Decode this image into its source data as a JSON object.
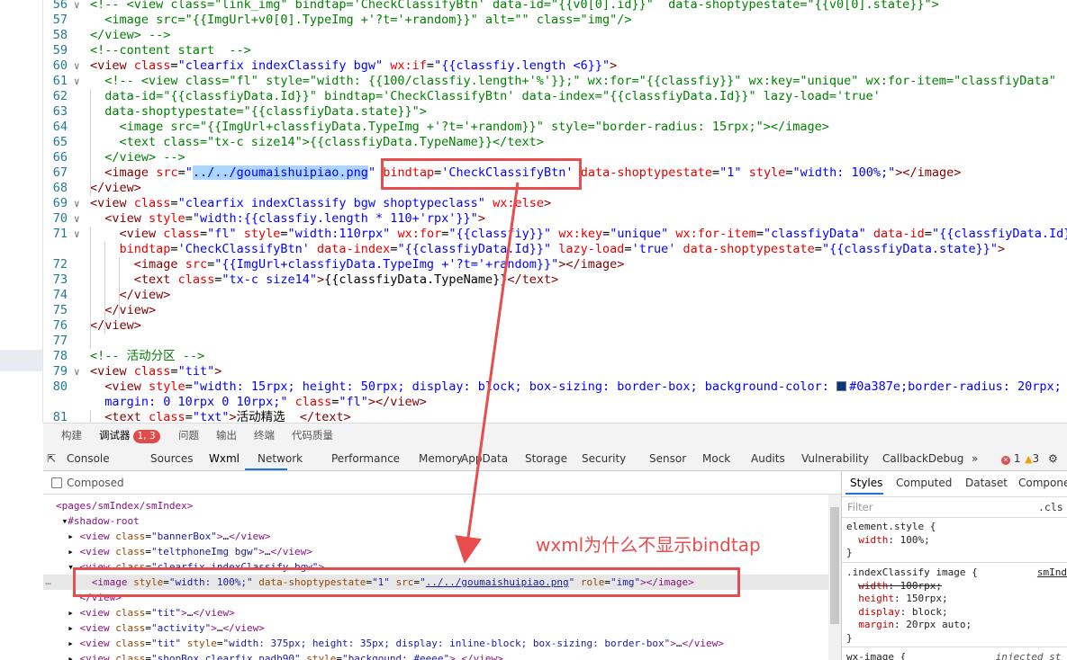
{
  "editor": {
    "lines": [
      {
        "num": "56",
        "fold": "∨",
        "html": "<span class=\"c\">&lt;!-- &lt;view class=\"link_img\" bindtap='CheckClassifyBtn' data-id=\"{{v0[0].id}}\"  data-shoptypestate=\"{{v0[0].state}}\"&gt;</span>"
      },
      {
        "num": "57",
        "fold": "",
        "html": "<span class=\"c\">  &lt;image src=\"{{ImgUrl+v0[0].TypeImg +'?t='+random}}\" alt=\"\" class=\"img\"/&gt;</span>"
      },
      {
        "num": "58",
        "fold": "",
        "html": "<span class=\"c\">&lt;/view&gt; --&gt;</span>"
      },
      {
        "num": "59",
        "fold": "",
        "html": "<span class=\"c\">&lt;!--content start  --&gt;</span>"
      },
      {
        "num": "60",
        "fold": "∨",
        "html": "<span class=\"t\">&lt;view</span> <span class=\"a\">class</span>=<span class=\"v\">\"clearfix indexClassify bgw\"</span> <span class=\"a\">wx:if</span>=<span class=\"v\">\"{{classfiy.length &lt;6}}\"</span><span class=\"t\">&gt;</span>"
      },
      {
        "num": "61",
        "fold": "∨",
        "html": "<span class=\"c\">  &lt;!-- &lt;view class=\"fl\" style=\"width: {{100/classfiy.length+'%'}};\" wx:for=\"{{classfiy}}\" wx:key=\"unique\" wx:for-item=\"classfiyData\"</span>"
      },
      {
        "num": "62",
        "fold": "",
        "html": "<span class=\"c\">  data-id=\"{{classfiyData.Id}}\" bindtap='CheckClassifyBtn' data-index=\"{{classfiyData.Id}}\" lazy-load='true'</span>"
      },
      {
        "num": "63",
        "fold": "",
        "html": "<span class=\"c\">  data-shoptypestate=\"{{classfiyData.state}}\"&gt;</span>"
      },
      {
        "num": "64",
        "fold": "",
        "html": "<span class=\"c\">    &lt;image src=\"{{ImgUrl+classfiyData.TypeImg +'?t='+random}}\" style=\"border-radius: 15rpx;\"&gt;&lt;/image&gt;</span>"
      },
      {
        "num": "65",
        "fold": "",
        "html": "<span class=\"c\">    &lt;text class=\"tx-c size14\"&gt;{{classfiyData.TypeName}}&lt;/text&gt;</span>"
      },
      {
        "num": "66",
        "fold": "",
        "html": "<span class=\"c\">  &lt;/view&gt; --&gt;</span>"
      },
      {
        "num": "67",
        "fold": "",
        "html": "  <span class=\"t\">&lt;image</span> <span class=\"a\">src</span>=<span class=\"v\">\"<span class=\"sel\">../../goumaishuipiao.png</span>\"</span> <span class=\"a\">bindtap</span>=<span class=\"v\">'CheckClassifyBtn'</span> <span class=\"a\">data-shoptypestate</span>=<span class=\"v\">\"1\"</span> <span class=\"a\">style</span>=<span class=\"v\">\"width: 100%;\"</span><span class=\"t\">&gt;&lt;/image&gt;</span>"
      },
      {
        "num": "68",
        "fold": "",
        "html": "<span class=\"t\">&lt;/view&gt;</span>"
      },
      {
        "num": "69",
        "fold": "∨",
        "html": "<span class=\"t\">&lt;view</span> <span class=\"a\">class</span>=<span class=\"v\">\"clearfix indexClassify bgw shoptypeclass\"</span> <span class=\"a\">wx:else</span><span class=\"t\">&gt;</span>"
      },
      {
        "num": "70",
        "fold": "∨",
        "html": "  <span class=\"t\">&lt;view</span> <span class=\"a\">style</span>=<span class=\"v\">\"width:{{classfiy.length * 110+'rpx'}}\"</span><span class=\"t\">&gt;</span>"
      },
      {
        "num": "71",
        "fold": "∨",
        "html": "    <span class=\"t\">&lt;view</span> <span class=\"a\">class</span>=<span class=\"v\">\"fl\"</span> <span class=\"a\">style</span>=<span class=\"v\">\"width:110rpx\"</span> <span class=\"a\">wx:for</span>=<span class=\"v\">\"{{classfiy}}\"</span> <span class=\"a\">wx:key</span>=<span class=\"v\">\"unique\"</span> <span class=\"a\">wx:for-item</span>=<span class=\"v\">\"classfiyData\"</span> <span class=\"a\">data-id</span>=<span class=\"v\">\"{{classfiyData.Id}}\"</span>"
      },
      {
        "num": "",
        "fold": "",
        "html": "    <span class=\"a\">bindtap</span>=<span class=\"v\">'CheckClassifyBtn'</span> <span class=\"a\">data-index</span>=<span class=\"v\">\"{{classfiyData.Id}}\"</span> <span class=\"a\">lazy-load</span>=<span class=\"v\">'true'</span> <span class=\"a\">data-shoptypestate</span>=<span class=\"v\">\"{{classfiyData.state}}\"</span><span class=\"t\">&gt;</span>"
      },
      {
        "num": "72",
        "fold": "",
        "html": "      <span class=\"t\">&lt;image</span> <span class=\"a\">src</span>=<span class=\"v\">\"{{ImgUrl+classfiyData.TypeImg +'?t='+random}}\"</span><span class=\"t\">&gt;&lt;/image&gt;</span>"
      },
      {
        "num": "73",
        "fold": "",
        "html": "      <span class=\"t\">&lt;text</span> <span class=\"a\">class</span>=<span class=\"v\">\"tx-c size14\"</span><span class=\"t\">&gt;</span>{{classfiyData.TypeName}}<span class=\"t\">&lt;/text&gt;</span>"
      },
      {
        "num": "74",
        "fold": "",
        "html": "    <span class=\"t\">&lt;/view&gt;</span>"
      },
      {
        "num": "75",
        "fold": "",
        "html": "  <span class=\"t\">&lt;/view&gt;</span>"
      },
      {
        "num": "76",
        "fold": "",
        "html": "<span class=\"t\">&lt;/view&gt;</span>"
      },
      {
        "num": "77",
        "fold": "",
        "html": ""
      },
      {
        "num": "78",
        "fold": "",
        "html": "<span class=\"c\">&lt;!-- 活动分区 --&gt;</span>"
      },
      {
        "num": "79",
        "fold": "∨",
        "html": "<span class=\"t\">&lt;view</span> <span class=\"a\">class</span>=<span class=\"v\">\"tit\"</span><span class=\"t\">&gt;</span>"
      },
      {
        "num": "80",
        "fold": "",
        "html": "  <span class=\"t\">&lt;view</span> <span class=\"a\">style</span>=<span class=\"v\">\"width: 15rpx; height: 50rpx; display: block; box-sizing: border-box; background-color: <span class=\"swatch\"></span>#0a387e;border-radius: 20rpx;</span>"
      },
      {
        "num": "",
        "fold": "",
        "html": "<span class=\"v\">  margin: 0 10rpx 0 10rpx;\"</span> <span class=\"a\">class</span>=<span class=\"v\">\"fl\"</span><span class=\"t\">&gt;&lt;/view&gt;</span>"
      },
      {
        "num": "81",
        "fold": "",
        "html": "  <span class=\"t\">&lt;text</span> <span class=\"a\">class</span>=<span class=\"v\">\"txt\"</span><span class=\"t\">&gt;</span>活动精选  <span class=\"t\">&lt;/text&gt;</span>"
      }
    ]
  },
  "panel_tabs": [
    {
      "label": "构建",
      "badge": ""
    },
    {
      "label": "调试器",
      "badge": "1, 3"
    },
    {
      "label": "问题",
      "badge": ""
    },
    {
      "label": "输出",
      "badge": ""
    },
    {
      "label": "终端",
      "badge": ""
    },
    {
      "label": "代码质量",
      "badge": ""
    }
  ],
  "devtools_tabs": [
    "Console",
    "Sources",
    "Wxml",
    "Network",
    "Performance",
    "Memory",
    "AppData",
    "Storage",
    "Security",
    "Sensor",
    "Mock",
    "Audits",
    "Vulnerability",
    "CallbackDebug"
  ],
  "more_tabs": "»",
  "error_count": "1",
  "warning_count": "3",
  "composed_label": "Composed",
  "tree": [
    {
      "html": "<span class=\"tg\">&lt;pages/smIndex/smIndex&gt;</span>"
    },
    {
      "html": " ▾<span class=\"tg\">#shadow-root</span>"
    },
    {
      "html": "  ▸ <span class=\"tg\">&lt;view</span> <span class=\"an\">class</span>=<span class=\"av\">\"bannerBox\"</span><span class=\"tg\">&gt;</span>…<span class=\"tg\">&lt;/view&gt;</span>"
    },
    {
      "html": "  ▸ <span class=\"tg\">&lt;view</span> <span class=\"an\">class</span>=<span class=\"av\">\"teltphoneImg bgw\"</span><span class=\"tg\">&gt;</span>…<span class=\"tg\">&lt;/view&gt;</span>"
    },
    {
      "html": "  ▾ <span class=\"tg\">&lt;view</span> <span class=\"an\">class</span>=<span class=\"av\">\"clearfix indexClassify bgw\"</span><span class=\"tg\">&gt;</span>"
    },
    {
      "html": "      <span class=\"tg\">&lt;image</span> <span class=\"an\">style</span>=<span class=\"av\">\"width: 100%;\"</span> <span class=\"an\">data-shoptypestate</span>=<span class=\"av\">\"1\"</span> <span class=\"an\">src</span>=<span class=\"av\">\"</span><span class=\"lk\">../../goumaishuipiao.png</span><span class=\"av\">\"</span> <span class=\"an\">role</span>=<span class=\"av\">\"img\"</span><span class=\"tg\">&gt;&lt;/image&gt;</span>",
      "hl": true
    },
    {
      "html": "    <span class=\"tg\">&lt;/view&gt;</span>"
    },
    {
      "html": "  ▸ <span class=\"tg\">&lt;view</span> <span class=\"an\">class</span>=<span class=\"av\">\"tit\"</span><span class=\"tg\">&gt;</span>…<span class=\"tg\">&lt;/view&gt;</span>"
    },
    {
      "html": "  ▸ <span class=\"tg\">&lt;view</span> <span class=\"an\">class</span>=<span class=\"av\">\"activity\"</span><span class=\"tg\">&gt;</span>…<span class=\"tg\">&lt;/view&gt;</span>"
    },
    {
      "html": "  ▸ <span class=\"tg\">&lt;view</span> <span class=\"an\">class</span>=<span class=\"av\">\"tit\"</span> <span class=\"an\">style</span>=<span class=\"av\">\"width: 375px; height: 35px; display: inline-block; box-sizing: border-box\"</span><span class=\"tg\">&gt;</span>…<span class=\"tg\">&lt;/view&gt;</span>"
    },
    {
      "html": "  ▸ <span class=\"tg\">&lt;view</span> <span class=\"an\">class</span>=<span class=\"av\">\"shopBox clearfix padb90\"</span> <span class=\"an\">style</span>=<span class=\"av\">\"backgound: #eeee\"</span><span class=\"tg\">&gt;</span>…<span class=\"tg\">&lt;/view&gt;</span>"
    }
  ],
  "tree_dots": "…",
  "styles_tabs": [
    "Styles",
    "Computed",
    "Dataset",
    "Componen"
  ],
  "filter_placeholder": "Filter",
  "cls_label": ".cls",
  "rules": [
    {
      "html": "element.style {\n  <span class=\"pn\">width</span>: 100%;\n}"
    },
    {
      "html": ".indexClassify image {          <span class=\"src\">smIndex.</span>\n  <span class=\"strike\"><span class=\"pn\">width</span>: 100rpx;</span>\n  <span class=\"pn\">height</span>: 150rpx;\n  <span class=\"pn\">display</span>: block;\n  <span class=\"pn\">margin</span>: 20rpx auto;\n}"
    },
    {
      "html": "wx-image {               <span style=\"font-style:italic;color:#555\">injected st</span>"
    }
  ],
  "annotation_text": "wxml为什么不显示bindtap",
  "colors": {
    "annotation": "#e84c4c",
    "selection": "#add6ff",
    "tab_accent": "#1a73e8"
  }
}
